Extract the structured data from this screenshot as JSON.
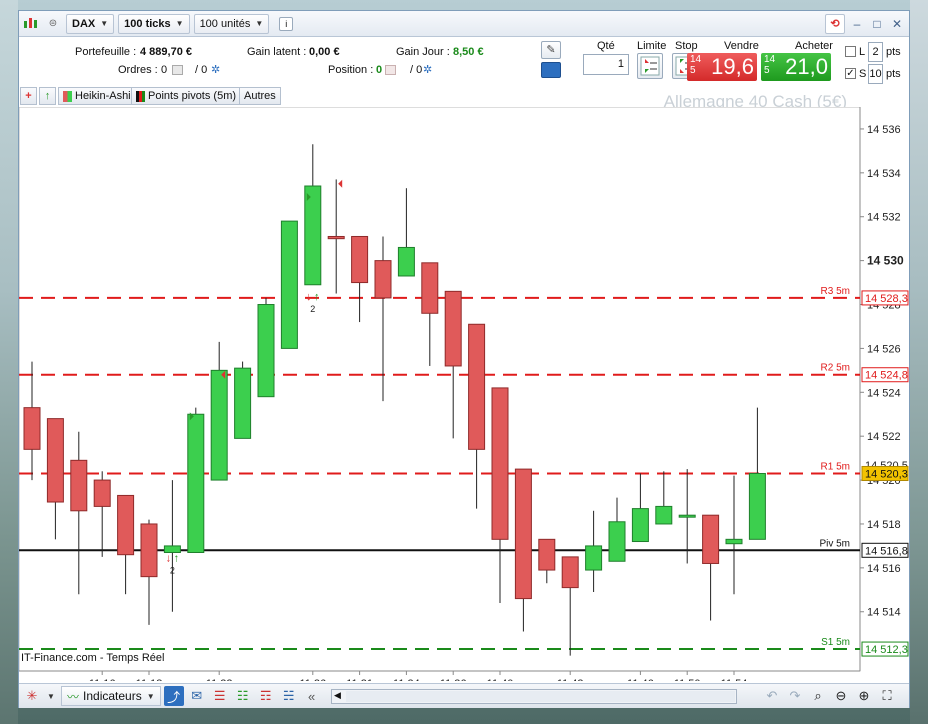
{
  "toolbar": {
    "instrument": "DAX",
    "ticks": "100 ticks",
    "units": "100 unités",
    "info_icon": "info-icon"
  },
  "account": {
    "portfolio_label": "Portefeuille :",
    "portfolio_value": "4 889,70 €",
    "latent_label": "Gain latent :",
    "latent_value": "0,00 €",
    "day_label": "Gain Jour :",
    "day_value": "8,50 €",
    "orders_label": "Ordres :",
    "orders_value": "0",
    "orders_value2": "/ 0",
    "position_label": "Position :",
    "position_value": "0",
    "position_value2": "/ 0"
  },
  "order": {
    "qty_label": "Qté",
    "qty_value": "1",
    "limit_label": "Limite",
    "stop_label": "Stop",
    "sell_label": "Vendre",
    "buy_label": "Acheter",
    "sell_prefix": "14 5",
    "sell_price": "19,6",
    "buy_prefix": "14 5",
    "buy_price": "21,0",
    "l_label": "L",
    "l_value": "2",
    "s_label": "S",
    "s_value": "10",
    "pts_label": "pts"
  },
  "indicators": {
    "tab1": "Heikin-Ashi",
    "tab2": "Points pivots (5m)",
    "tab3": "Autres"
  },
  "instrument_title": "Allemagne 40 Cash (5€)",
  "source": "IT-Finance.com - Temps Réel",
  "bottom": {
    "indicators_button": "Indicateurs"
  },
  "colors": {
    "up": "#3ccf4e",
    "down": "#e05a5a",
    "resistance": "#e01b1b",
    "support": "#1a8a1a",
    "pivot": "#111111",
    "last_price": "#f2c200"
  },
  "chart_data": {
    "type": "candlestick",
    "title": "Allemagne 40 Cash (5€)",
    "ylim": [
      14511.3,
      14537.0
    ],
    "y_ticks": [
      14514,
      14516,
      14518,
      14520,
      14522,
      14524,
      14526,
      14528,
      14530,
      14532,
      14534,
      14536
    ],
    "y_tick_labels": [
      "14 514",
      "14 516",
      "14 518",
      "14 520",
      "14 522",
      "14 524",
      "14 526",
      "14 528",
      "14 530",
      "14 532",
      "14 534",
      "14 536"
    ],
    "x_tick_labels": [
      {
        "index": 3,
        "label": "11:16"
      },
      {
        "index": 5,
        "label": "11:18"
      },
      {
        "index": 8,
        "label": "11:22"
      },
      {
        "index": 12,
        "label": "11:26"
      },
      {
        "index": 14,
        "label": "11:31"
      },
      {
        "index": 16,
        "label": "11:34"
      },
      {
        "index": 18,
        "label": "11:36"
      },
      {
        "index": 20,
        "label": "11:40"
      },
      {
        "index": 23,
        "label": "11:43"
      },
      {
        "index": 26,
        "label": "11:46"
      },
      {
        "index": 28,
        "label": "11:50"
      },
      {
        "index": 30,
        "label": "11:54"
      }
    ],
    "candles": [
      {
        "o": 14523.3,
        "c": 14521.4,
        "h": 14525.4,
        "l": 14520.0
      },
      {
        "o": 14522.8,
        "c": 14519.0,
        "h": 14522.8,
        "l": 14517.3
      },
      {
        "o": 14520.9,
        "c": 14518.6,
        "h": 14522.2,
        "l": 14514.8
      },
      {
        "o": 14520.0,
        "c": 14518.8,
        "h": 14520.4,
        "l": 14516.5
      },
      {
        "o": 14519.3,
        "c": 14516.6,
        "h": 14519.3,
        "l": 14514.8
      },
      {
        "o": 14518.0,
        "c": 14515.6,
        "h": 14518.2,
        "l": 14513.4
      },
      {
        "o": 14516.7,
        "c": 14517.0,
        "h": 14520.0,
        "l": 14514.0
      },
      {
        "o": 14516.7,
        "c": 14523.0,
        "h": 14523.3,
        "l": 14516.7
      },
      {
        "o": 14520.0,
        "c": 14525.0,
        "h": 14526.3,
        "l": 14520.0
      },
      {
        "o": 14521.9,
        "c": 14525.1,
        "h": 14525.4,
        "l": 14521.9
      },
      {
        "o": 14523.8,
        "c": 14528.0,
        "h": 14528.3,
        "l": 14523.8
      },
      {
        "o": 14526.0,
        "c": 14531.8,
        "h": 14531.8,
        "l": 14526.0
      },
      {
        "o": 14528.9,
        "c": 14533.4,
        "h": 14535.3,
        "l": 14528.9
      },
      {
        "o": 14531.1,
        "c": 14531.0,
        "h": 14533.7,
        "l": 14528.5
      },
      {
        "o": 14531.1,
        "c": 14529.0,
        "h": 14531.1,
        "l": 14527.2
      },
      {
        "o": 14530.0,
        "c": 14528.3,
        "h": 14531.1,
        "l": 14523.6
      },
      {
        "o": 14529.3,
        "c": 14530.6,
        "h": 14533.3,
        "l": 14529.3
      },
      {
        "o": 14529.9,
        "c": 14527.6,
        "h": 14529.9,
        "l": 14525.2
      },
      {
        "o": 14528.6,
        "c": 14525.2,
        "h": 14528.6,
        "l": 14521.9
      },
      {
        "o": 14527.1,
        "c": 14521.4,
        "h": 14527.1,
        "l": 14518.7
      },
      {
        "o": 14524.2,
        "c": 14517.3,
        "h": 14524.2,
        "l": 14514.4
      },
      {
        "o": 14520.5,
        "c": 14514.6,
        "h": 14520.5,
        "l": 14513.1
      },
      {
        "o": 14517.3,
        "c": 14515.9,
        "h": 14517.3,
        "l": 14515.3
      },
      {
        "o": 14516.5,
        "c": 14515.1,
        "h": 14516.5,
        "l": 14512.0
      },
      {
        "o": 14515.9,
        "c": 14517.0,
        "h": 14518.6,
        "l": 14514.9
      },
      {
        "o": 14516.3,
        "c": 14518.1,
        "h": 14519.2,
        "l": 14516.3
      },
      {
        "o": 14517.2,
        "c": 14518.7,
        "h": 14520.3,
        "l": 14517.2
      },
      {
        "o": 14518.0,
        "c": 14518.8,
        "h": 14520.4,
        "l": 14518.0
      },
      {
        "o": 14518.4,
        "c": 14518.4,
        "h": 14520.5,
        "l": 14516.2
      },
      {
        "o": 14518.4,
        "c": 14516.2,
        "h": 14518.4,
        "l": 14513.6
      },
      {
        "o": 14517.1,
        "c": 14517.3,
        "h": 14520.2,
        "l": 14514.8
      },
      {
        "o": 14517.3,
        "c": 14520.3,
        "h": 14523.3,
        "l": 14517.3
      }
    ],
    "lines": [
      {
        "name": "R3 5m",
        "value": 14528.3,
        "label": "14 528,3",
        "style": "dashed",
        "color": "#e01b1b"
      },
      {
        "name": "R2 5m",
        "value": 14524.8,
        "label": "14 524,8",
        "style": "dashed",
        "color": "#e01b1b"
      },
      {
        "name": "R1 5m",
        "value": 14520.3,
        "label": "14 520,3",
        "style": "dashed",
        "color": "#e01b1b"
      },
      {
        "name": "Piv 5m",
        "value": 14516.8,
        "label": "14 516,8",
        "style": "solid",
        "color": "#111111"
      },
      {
        "name": "S1 5m",
        "value": 14512.3,
        "label": "14 512,3",
        "style": "dashed",
        "color": "#1a8a1a"
      }
    ],
    "current_price": {
      "value": 14520.3,
      "label": "14 520,3"
    },
    "extra_labels": [
      {
        "value": 14520.5,
        "label": "14 520,5"
      }
    ],
    "bold_tick": "14 530",
    "markers": [
      {
        "index": 6,
        "label": "2",
        "value": 14516.3
      },
      {
        "index": 12,
        "label": "2",
        "value": 14528.2
      }
    ],
    "flags": [
      {
        "index": 7,
        "side": "up",
        "value": 14522.9
      },
      {
        "index": 8,
        "side": "down",
        "value": 14524.8
      },
      {
        "index": 12,
        "side": "up",
        "value": 14532.9
      },
      {
        "index": 13,
        "side": "down",
        "value": 14533.5
      }
    ],
    "grid": false
  }
}
